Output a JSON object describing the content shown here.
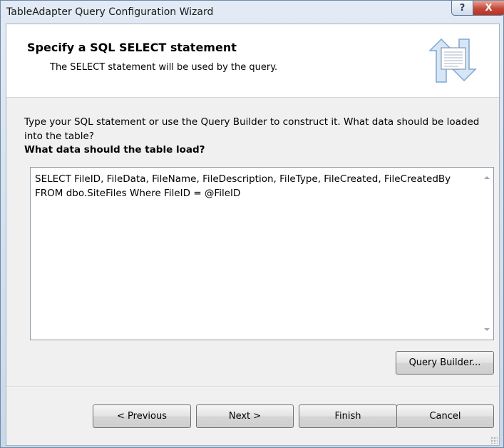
{
  "window": {
    "title": "TableAdapter Query Configuration Wizard",
    "help_label": "?",
    "close_label": "X"
  },
  "header": {
    "title": "Specify a SQL SELECT statement",
    "subtitle": "The SELECT statement will be used by the query."
  },
  "main": {
    "instructions": "Type your SQL statement or use the Query Builder to construct it. What data should be loaded into the table?",
    "question": "What data should the table load?",
    "sql_text": "SELECT FileID, FileData, FileName, FileDescription, FileType, FileCreated, FileCreatedBy FROM dbo.SiteFiles Where FileID = @FileID",
    "query_builder_label": "Query Builder..."
  },
  "footer": {
    "previous_label": "< Previous",
    "next_label": "Next >",
    "finish_label": "Finish",
    "cancel_label": "Cancel"
  }
}
